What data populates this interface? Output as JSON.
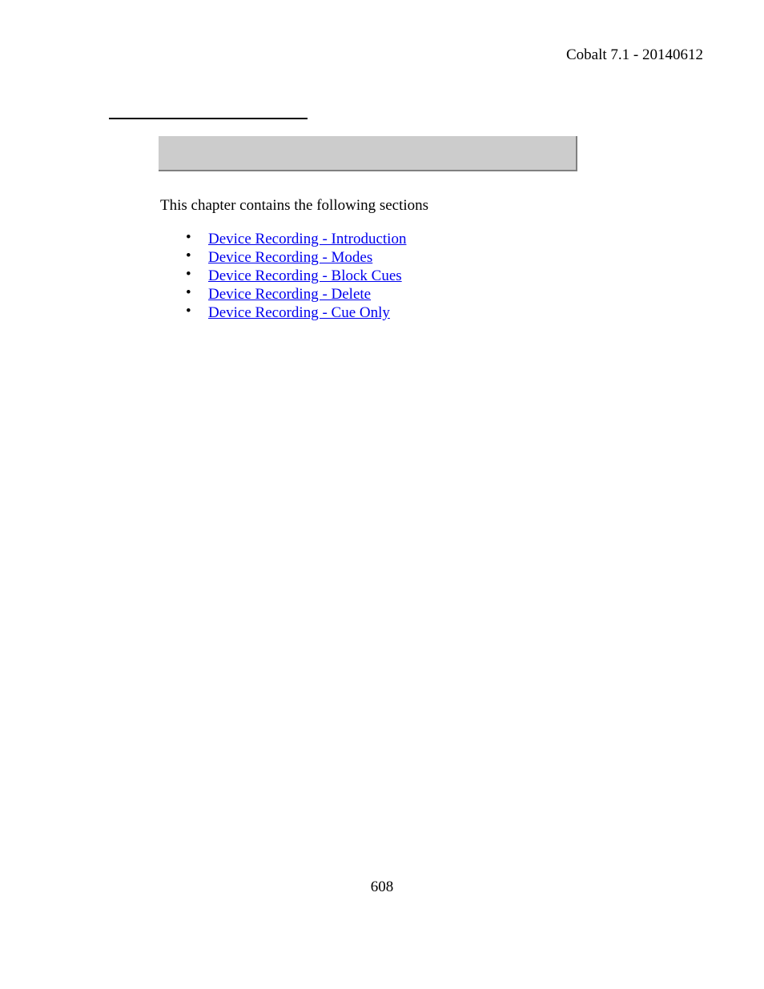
{
  "header": {
    "text": "Cobalt 7.1 - 20140612"
  },
  "intro": "This chapter contains the following sections",
  "links": [
    {
      "label": "Device Recording - Introduction"
    },
    {
      "label": "Device Recording - Modes"
    },
    {
      "label": "Device Recording - Block Cues"
    },
    {
      "label": "Device Recording - Delete"
    },
    {
      "label": "Device Recording - Cue Only"
    }
  ],
  "pageNumber": "608"
}
